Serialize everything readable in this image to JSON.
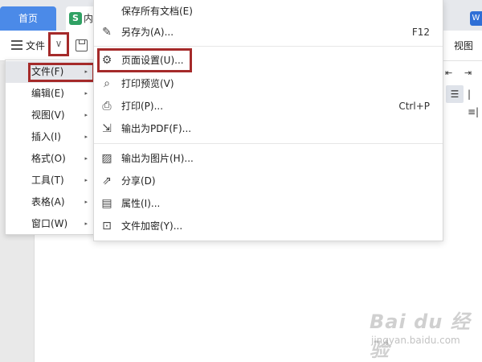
{
  "tabbar": {
    "home_label": "首页",
    "doc_tab_icon": "S",
    "doc_tab_label": "内",
    "right_tab_icon": "W"
  },
  "toolbar": {
    "file_label": "文件",
    "dropdown_glyph": "∨",
    "view_label": "视图",
    "indent_left_glyph": "⇤",
    "indent_right_glyph": "⇥",
    "justify_glyph": "☰",
    "distribute_glyph": "|≡|"
  },
  "main_menu": {
    "items": [
      {
        "label": "文件(F)",
        "arrow": "▸"
      },
      {
        "label": "编辑(E)",
        "arrow": "▸"
      },
      {
        "label": "视图(V)",
        "arrow": "▸"
      },
      {
        "label": "插入(I)",
        "arrow": "▸"
      },
      {
        "label": "格式(O)",
        "arrow": "▸"
      },
      {
        "label": "工具(T)",
        "arrow": "▸"
      },
      {
        "label": "表格(A)",
        "arrow": "▸"
      },
      {
        "label": "窗口(W)",
        "arrow": "▸"
      }
    ]
  },
  "submenu": {
    "items": [
      {
        "label": "保存所有文档(E)",
        "shortcut": "",
        "icon": "save-all-icon",
        "glyph": ""
      },
      {
        "label": "另存为(A)...",
        "shortcut": "F12",
        "icon": "save-as-icon",
        "glyph": "✎"
      },
      {
        "label": "页面设置(U)...",
        "shortcut": "",
        "icon": "page-setup-icon",
        "glyph": "⚙"
      },
      {
        "label": "打印预览(V)",
        "shortcut": "",
        "icon": "print-preview-icon",
        "glyph": "⌕"
      },
      {
        "label": "打印(P)...",
        "shortcut": "Ctrl+P",
        "icon": "printer-icon",
        "glyph": "⎙"
      },
      {
        "label": "输出为PDF(F)...",
        "shortcut": "",
        "icon": "pdf-export-icon",
        "glyph": "⇲"
      },
      {
        "label": "输出为图片(H)...",
        "shortcut": "",
        "icon": "image-export-icon",
        "glyph": "▨"
      },
      {
        "label": "分享(D)",
        "shortcut": "",
        "icon": "share-icon",
        "glyph": "⇗"
      },
      {
        "label": "属性(I)...",
        "shortcut": "",
        "icon": "properties-icon",
        "glyph": "▤"
      },
      {
        "label": "文件加密(Y)...",
        "shortcut": "",
        "icon": "encrypt-icon",
        "glyph": "⊡"
      }
    ]
  },
  "watermark": {
    "logo": "Bai du 经验",
    "url": "jingyan.baidu.com"
  },
  "colors": {
    "accent": "#4b8ae8",
    "highlight_border": "#a52a2a",
    "menu_selected_bg": "#e4e6ea"
  }
}
